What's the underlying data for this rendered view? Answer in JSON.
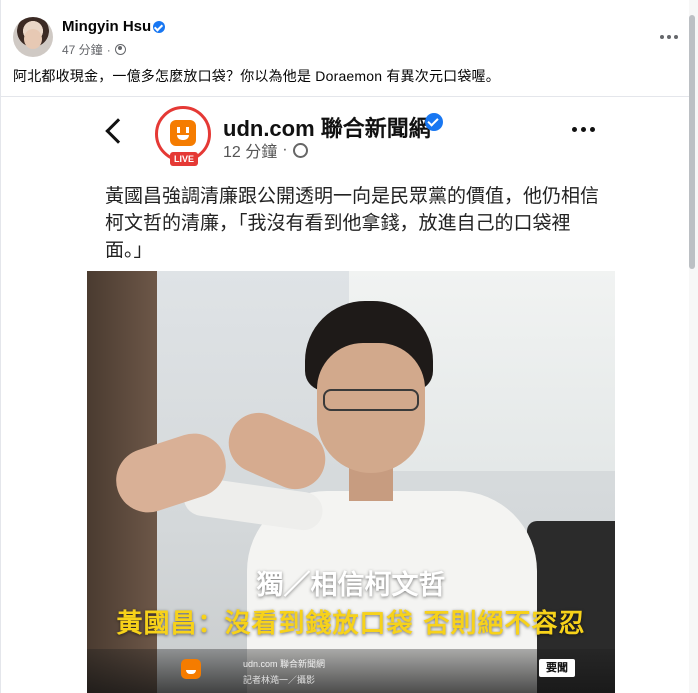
{
  "post": {
    "author": "Mingyin Hsu",
    "time": "47 分鐘",
    "separator": "·",
    "text": "阿北都收現金，一億多怎麼放口袋？你以為他是 Doraemon 有異次元口袋喔。"
  },
  "shared": {
    "page_name": "udn.com 聯合新聞網",
    "live_label": "LIVE",
    "time": "12 分鐘",
    "separator": "·",
    "quote": "黃國昌強調清廉跟公開透明一向是民眾黨的價值，他仍相信柯文哲的清廉，「我沒有看到他拿錢，放進自己的口袋裡面。」",
    "caption_line1": "獨／相信柯文哲",
    "caption_line2": "黃國昌：沒看到錢放口袋 否則絕不容忍",
    "footer_site": "udn.com 聯合新聞網",
    "footer_credit": "記者林澔一／攝影",
    "footer_tag": "要聞"
  },
  "colors": {
    "verified_blue": "#1877f2",
    "live_red": "#e53935",
    "caption_yellow": "#f7d21a",
    "udn_orange": "#f57c00"
  },
  "icons": [
    "globe-icon",
    "more-icon",
    "back-icon",
    "verified-icon"
  ]
}
